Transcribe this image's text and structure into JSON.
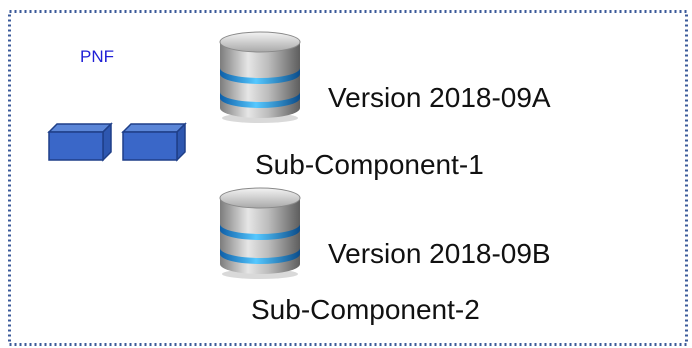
{
  "pnf": {
    "label": "PNF",
    "color": "#3A67C8"
  },
  "components": [
    {
      "version": "Version 2018-09A",
      "name": "Sub-Component-1"
    },
    {
      "version": "Version 2018-09B",
      "name": "Sub-Component-2"
    }
  ],
  "frame": {
    "border_color": "#3B5A9A",
    "border_style": "dotted"
  }
}
